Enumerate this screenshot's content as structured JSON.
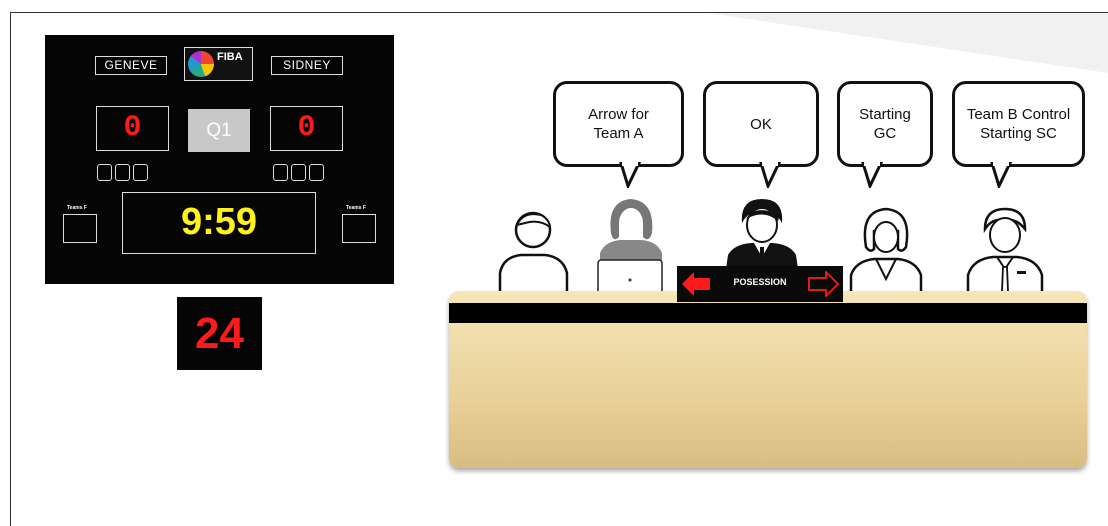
{
  "scoreboard": {
    "home_team": "GENEVE",
    "away_team": "SIDNEY",
    "logo_text": "FIBA",
    "home_score": "0",
    "away_score": "0",
    "quarter": "Q1",
    "home_team_fouls_label": "Teams F",
    "away_team_fouls_label": "Teams F",
    "game_clock": "9:59",
    "shot_clock": "24"
  },
  "bubbles": [
    {
      "text": "Arrow for Team A"
    },
    {
      "text": "OK"
    },
    {
      "text": "Starting GC"
    },
    {
      "text": "Team B Control Starting SC"
    }
  ],
  "possession": {
    "label": "POSESSION",
    "left_arrow": "filled",
    "right_arrow": "outline"
  },
  "colors": {
    "score": "#ff1a1a",
    "clock": "#fff21a",
    "table": "#e9d199",
    "arrow": "#ff1a1a"
  }
}
